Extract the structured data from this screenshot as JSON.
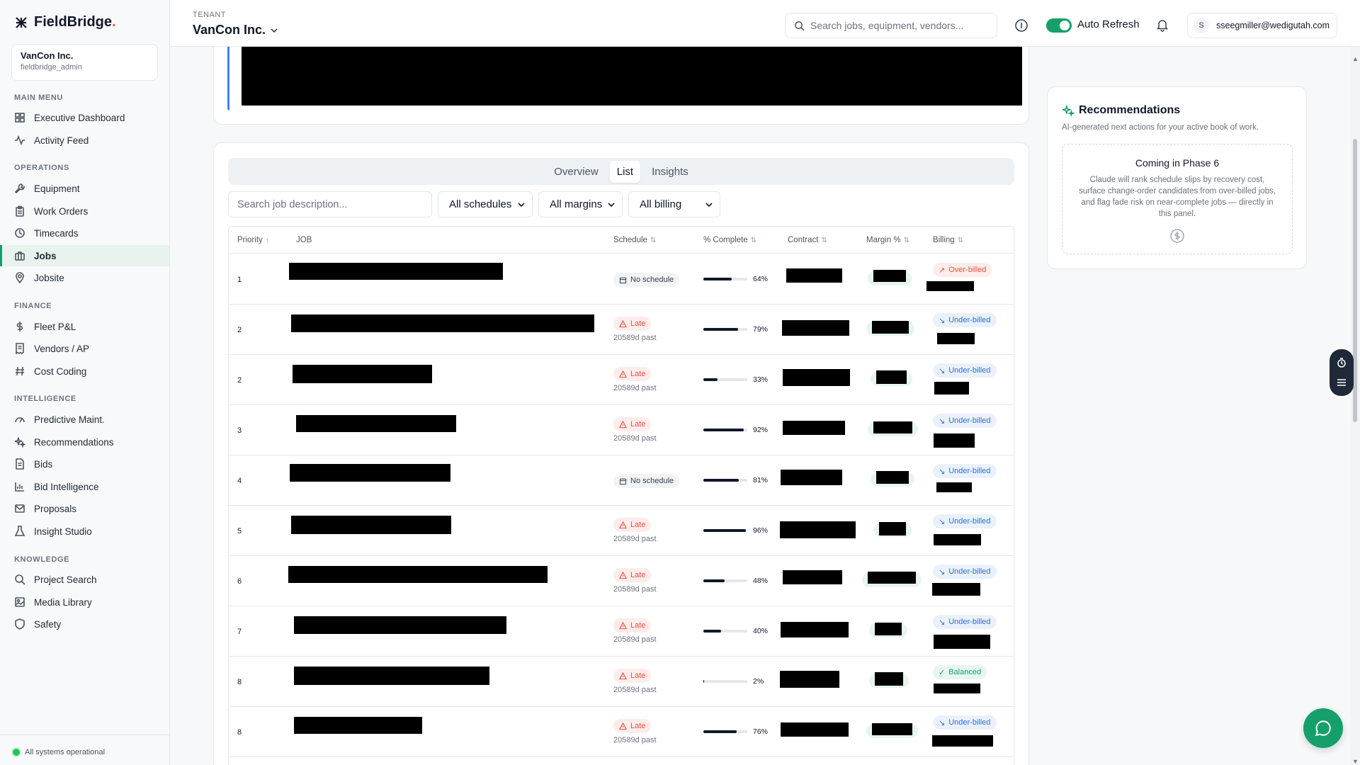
{
  "app": {
    "name": "FieldBridge",
    "name_dot": "."
  },
  "sidebar": {
    "tenant_name": "VanCon Inc.",
    "tenant_user": "fieldbridge_admin",
    "sections": {
      "main": "MAIN MENU",
      "operations": "OPERATIONS",
      "finance": "FINANCE",
      "intelligence": "INTELLIGENCE",
      "knowledge": "KNOWLEDGE"
    },
    "items": [
      {
        "label": "Executive Dashboard",
        "icon": "dashboard-icon"
      },
      {
        "label": "Activity Feed",
        "icon": "activity-icon"
      },
      {
        "label": "Equipment",
        "icon": "wrench-icon"
      },
      {
        "label": "Work Orders",
        "icon": "clipboard-icon"
      },
      {
        "label": "Timecards",
        "icon": "clock-icon"
      },
      {
        "label": "Jobs",
        "icon": "briefcase-icon"
      },
      {
        "label": "Jobsite",
        "icon": "map-pin-icon"
      },
      {
        "label": "Fleet P&L",
        "icon": "dollar-icon"
      },
      {
        "label": "Vendors / AP",
        "icon": "receipt-icon"
      },
      {
        "label": "Cost Coding",
        "icon": "hash-icon"
      },
      {
        "label": "Predictive Maint.",
        "icon": "gauge-icon"
      },
      {
        "label": "Recommendations",
        "icon": "sparkles-icon"
      },
      {
        "label": "Bids",
        "icon": "file-icon"
      },
      {
        "label": "Bid Intelligence",
        "icon": "chart-icon"
      },
      {
        "label": "Proposals",
        "icon": "mail-icon"
      },
      {
        "label": "Insight Studio",
        "icon": "flask-icon"
      },
      {
        "label": "Project Search",
        "icon": "search-icon"
      },
      {
        "label": "Media Library",
        "icon": "image-icon"
      },
      {
        "label": "Safety",
        "icon": "shield-icon"
      }
    ],
    "active_item": "Jobs",
    "status": "All systems operational"
  },
  "header": {
    "tenant_label": "TENANT",
    "tenant_value": "VanCon Inc.",
    "search_placeholder": "Search jobs, equipment, vendors...",
    "auto_refresh_label": "Auto Refresh",
    "auto_refresh_on": true,
    "user_initial": "S",
    "user_email": "sseegmiller@wedigutah.com"
  },
  "jobs": {
    "tabs": [
      "Overview",
      "List",
      "Insights"
    ],
    "active_tab": "List",
    "filter_search_placeholder": "Search job description...",
    "filters": [
      "All schedules",
      "All margins",
      "All billing"
    ],
    "columns": [
      "Priority",
      "JOB",
      "Schedule",
      "% Complete",
      "Contract",
      "Margin %",
      "Billing"
    ],
    "rows": [
      {
        "priority": "1",
        "schedule": "No schedule",
        "schedule_type": "none",
        "sub": "",
        "pct": 64,
        "pct_label": "64%",
        "billing": "Over-billed",
        "billing_type": "over"
      },
      {
        "priority": "2",
        "schedule": "Late",
        "schedule_type": "late",
        "sub": "20589d past",
        "pct": 79,
        "pct_label": "79%",
        "billing": "Under-billed",
        "billing_type": "under"
      },
      {
        "priority": "2",
        "schedule": "Late",
        "schedule_type": "late",
        "sub": "20589d past",
        "pct": 33,
        "pct_label": "33%",
        "billing": "Under-billed",
        "billing_type": "under"
      },
      {
        "priority": "3",
        "schedule": "Late",
        "schedule_type": "late",
        "sub": "20589d past",
        "pct": 92,
        "pct_label": "92%",
        "billing": "Under-billed",
        "billing_type": "under"
      },
      {
        "priority": "4",
        "schedule": "No schedule",
        "schedule_type": "none",
        "sub": "",
        "pct": 81,
        "pct_label": "81%",
        "billing": "Under-billed",
        "billing_type": "under"
      },
      {
        "priority": "5",
        "schedule": "Late",
        "schedule_type": "late",
        "sub": "20589d past",
        "pct": 96,
        "pct_label": "96%",
        "billing": "Under-billed",
        "billing_type": "under"
      },
      {
        "priority": "6",
        "schedule": "Late",
        "schedule_type": "late",
        "sub": "20589d past",
        "pct": 48,
        "pct_label": "48%",
        "billing": "Under-billed",
        "billing_type": "under"
      },
      {
        "priority": "7",
        "schedule": "Late",
        "schedule_type": "late",
        "sub": "20589d past",
        "pct": 40,
        "pct_label": "40%",
        "billing": "Under-billed",
        "billing_type": "under"
      },
      {
        "priority": "8",
        "schedule": "Late",
        "schedule_type": "late",
        "sub": "20589d past",
        "pct": 2,
        "pct_label": "2%",
        "billing": "Balanced",
        "billing_type": "balanced"
      },
      {
        "priority": "8",
        "schedule": "Late",
        "schedule_type": "late",
        "sub": "20589d past",
        "pct": 76,
        "pct_label": "76%",
        "billing": "Under-billed",
        "billing_type": "under"
      }
    ]
  },
  "recommendations": {
    "title": "Recommendations",
    "subtitle": "AI-generated next actions for your active book of work.",
    "placeholder_title": "Coming in Phase 6",
    "placeholder_body": "Claude will rank schedule slips by recovery cost, surface change-order candidates from over-billed jobs, and flag fade risk on near-complete jobs — directly in this panel."
  },
  "colors": {
    "accent": "#15a06b",
    "late": "#e5533d",
    "under": "#2f6fdb"
  }
}
